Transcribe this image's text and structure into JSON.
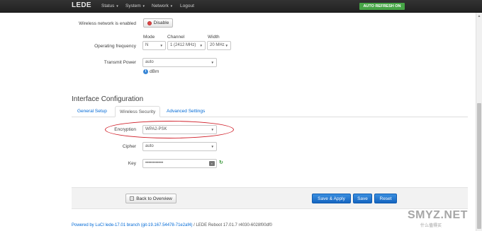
{
  "nav": {
    "brand": "LEDE",
    "items": [
      {
        "label": "Status",
        "caret": "▾"
      },
      {
        "label": "System",
        "caret": "▾"
      },
      {
        "label": "Network",
        "caret": "▾"
      },
      {
        "label": "Logout",
        "caret": ""
      }
    ],
    "auto_refresh": "AUTO REFRESH ON"
  },
  "device": {
    "wireless_enabled_label": "Wireless network is enabled",
    "disable_button": "Disable",
    "mode_header": "Mode",
    "channel_header": "Channel",
    "width_header": "Width",
    "operating_frequency_label": "Operating frequency",
    "mode_value": "N",
    "channel_value": "1 (2412 MHz)",
    "width_value": "20 MHz",
    "transmit_power_label": "Transmit Power",
    "transmit_power_value": "auto",
    "transmit_power_unit": "dBm"
  },
  "interface": {
    "title": "Interface Configuration",
    "tabs": [
      {
        "label": "General Setup",
        "active": false
      },
      {
        "label": "Wireless Security",
        "active": true
      },
      {
        "label": "Advanced Settings",
        "active": false
      }
    ],
    "encryption_label": "Encryption",
    "encryption_value": "WPA2-PSK",
    "cipher_label": "Cipher",
    "cipher_value": "auto",
    "key_label": "Key",
    "key_value": "••••••••••••"
  },
  "actions": {
    "back_label": "Back to Overview",
    "save_apply_label": "Save & Apply",
    "save_label": "Save",
    "reset_label": "Reset"
  },
  "footer": {
    "powered_by": "Powered by LuCI lede-17.01 branch (git-19.167.54478-71e2af4)",
    "separator": " / ",
    "version": "LEDE Reboot 17.01.7 r4030-6028f00df0"
  },
  "watermark": {
    "text": "SMYZ.NET",
    "sub": "什么值得买"
  },
  "colors": {
    "accent_blue": "#0069d6",
    "nav_bg": "#222222",
    "auto_refresh_bg": "#46a546",
    "highlight": "#d0202a"
  }
}
